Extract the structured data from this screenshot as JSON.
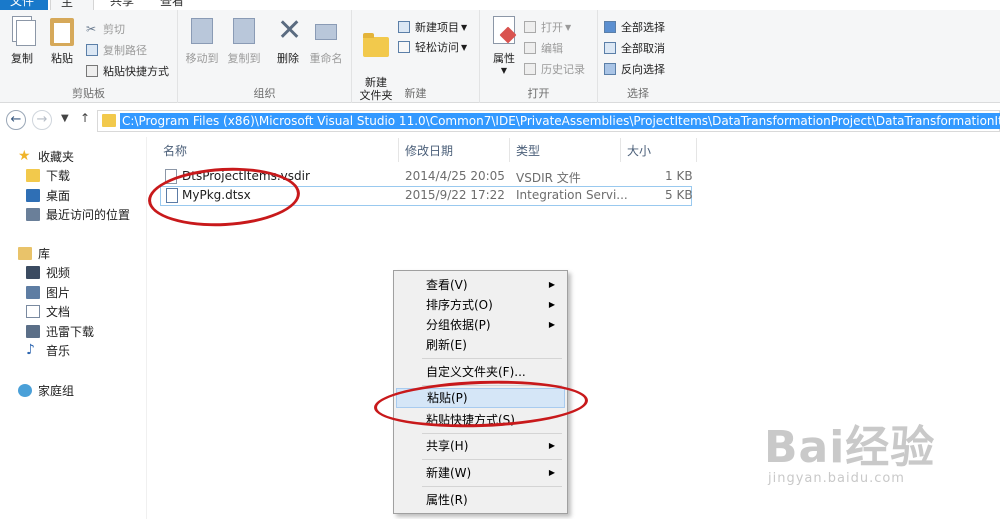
{
  "tabs": {
    "file": "文件",
    "home": "主页",
    "share": "共享",
    "view": "查看"
  },
  "ribbon": {
    "clipboard": {
      "label": "剪贴板",
      "copy": "复制",
      "paste": "粘贴",
      "cut": "剪切",
      "copy_path": "复制路径",
      "paste_shortcut": "粘贴快捷方式"
    },
    "organize": {
      "label": "组织",
      "move_to": "移动到",
      "copy_to": "复制到",
      "delete": "删除",
      "rename": "重命名"
    },
    "new": {
      "label": "新建",
      "new_folder": "新建\n文件夹",
      "new_item": "新建项目",
      "easy_access": "轻松访问"
    },
    "open": {
      "label": "打开",
      "properties": "属性",
      "open": "打开",
      "edit": "编辑",
      "history": "历史记录"
    },
    "select": {
      "label": "选择",
      "select_all": "全部选择",
      "select_none": "全部取消",
      "invert": "反向选择"
    }
  },
  "address": {
    "path": "C:\\Program Files (x86)\\Microsoft Visual Studio 11.0\\Common7\\IDE\\PrivateAssemblies\\ProjectItems\\DataTransformationProject\\DataTransformationItems"
  },
  "navpane": {
    "favorites": "收藏夹",
    "downloads": "下载",
    "desktop": "桌面",
    "recent": "最近访问的位置",
    "libraries": "库",
    "videos": "视频",
    "pictures": "图片",
    "documents": "文档",
    "thunder": "迅雷下载",
    "music": "音乐",
    "homegroup": "家庭组"
  },
  "columns": {
    "name": "名称",
    "modified": "修改日期",
    "type": "类型",
    "size": "大小"
  },
  "files": [
    {
      "name": "DtsProjectItems.vsdir",
      "modified": "2014/4/25 20:05",
      "type": "VSDIR 文件",
      "size": "1 KB"
    },
    {
      "name": "MyPkg.dtsx",
      "modified": "2015/9/22 17:22",
      "type": "Integration Servi...",
      "size": "5 KB"
    }
  ],
  "context_menu": {
    "view": "查看(V)",
    "sort": "排序方式(O)",
    "group": "分组依据(P)",
    "refresh": "刷新(E)",
    "customize": "自定义文件夹(F)...",
    "paste": "粘贴(P)",
    "paste_shortcut": "粘贴快捷方式(S)",
    "share": "共享(H)",
    "new": "新建(W)",
    "properties": "属性(R)"
  },
  "watermark": {
    "brand": "Bai经验",
    "url": "jingyan.baidu.com"
  },
  "colors": {
    "selection": "#3399ff",
    "annotation": "#c8191b",
    "file_tab": "#1979ca"
  }
}
